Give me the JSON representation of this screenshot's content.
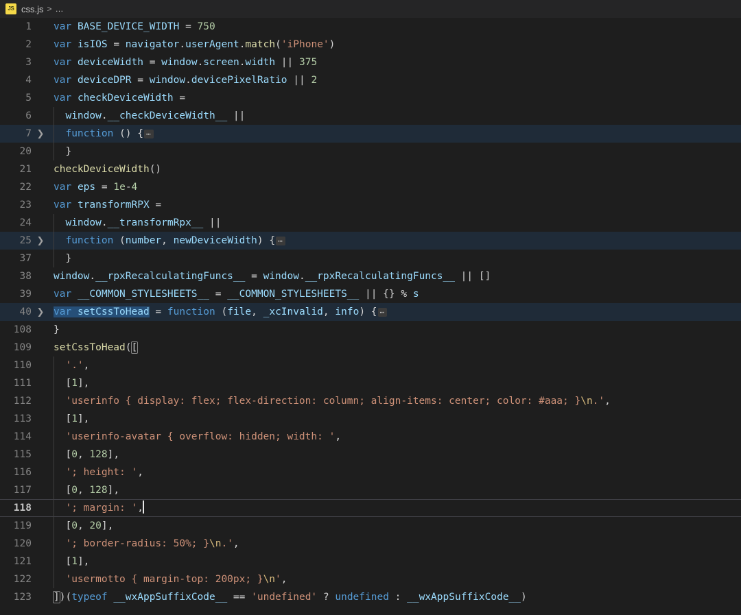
{
  "breadcrumb": {
    "file_icon_label": "JS",
    "file_name": "css.js",
    "separator": ">",
    "overflow": "…"
  },
  "editor": {
    "language": "javascript",
    "theme": "dark-plus",
    "active_line": 118,
    "colors": {
      "background": "#1e1e1e",
      "gutter_text": "#858585",
      "active_gutter_text": "#c6c6c6",
      "fold_highlight": "#1f2b38",
      "selection": "#264f78",
      "keyword": "#569cd6",
      "identifier": "#9cdcfe",
      "function": "#dcdcaa",
      "number": "#b5cea8",
      "string": "#ce9178",
      "escape": "#d7ba7d",
      "plain": "#d4d4d4",
      "indent_guide": "#404040",
      "caret": "#e8e8e8"
    },
    "lines": [
      {
        "n": "1",
        "text": "var BASE_DEVICE_WIDTH = 750"
      },
      {
        "n": "2",
        "text": "var isIOS = navigator.userAgent.match('iPhone')"
      },
      {
        "n": "3",
        "text": "var deviceWidth = window.screen.width || 375"
      },
      {
        "n": "4",
        "text": "var deviceDPR = window.devicePixelRatio || 2"
      },
      {
        "n": "5",
        "text": "var checkDeviceWidth ="
      },
      {
        "n": "6",
        "text": "  window.__checkDeviceWidth__ ||"
      },
      {
        "n": "7",
        "text": "  function () {…",
        "folded": true,
        "highlighted": true
      },
      {
        "n": "20",
        "text": "  }"
      },
      {
        "n": "21",
        "text": "checkDeviceWidth()"
      },
      {
        "n": "22",
        "text": "var eps = 1e-4"
      },
      {
        "n": "23",
        "text": "var transformRPX ="
      },
      {
        "n": "24",
        "text": "  window.__transformRpx__ ||"
      },
      {
        "n": "25",
        "text": "  function (number, newDeviceWidth) {…",
        "folded": true,
        "highlighted": true
      },
      {
        "n": "37",
        "text": "  }"
      },
      {
        "n": "38",
        "text": "window.__rpxRecalculatingFuncs__ = window.__rpxRecalculatingFuncs__ || []"
      },
      {
        "n": "39",
        "text": "var __COMMON_STYLESHEETS__ = __COMMON_STYLESHEETS__ || {} % s"
      },
      {
        "n": "40",
        "text": "var setCssToHead = function (file, _xcInvalid, info) {…",
        "folded": true,
        "highlighted": true,
        "selected_text": "var setCssToHead"
      },
      {
        "n": "108",
        "text": "}"
      },
      {
        "n": "109",
        "text": "setCssToHead(["
      },
      {
        "n": "110",
        "text": "  '.',"
      },
      {
        "n": "111",
        "text": "  [1],"
      },
      {
        "n": "112",
        "text": "  'userinfo { display: flex; flex-direction: column; align-items: center; color: #aaa; }\\n.',"
      },
      {
        "n": "113",
        "text": "  [1],"
      },
      {
        "n": "114",
        "text": "  'userinfo-avatar { overflow: hidden; width: ',"
      },
      {
        "n": "115",
        "text": "  [0, 128],"
      },
      {
        "n": "116",
        "text": "  '; height: ',"
      },
      {
        "n": "117",
        "text": "  [0, 128],"
      },
      {
        "n": "118",
        "text": "  '; margin: ',",
        "active": true,
        "caret_after": true
      },
      {
        "n": "119",
        "text": "  [0, 20],"
      },
      {
        "n": "120",
        "text": "  '; border-radius: 50%; }\\n.',"
      },
      {
        "n": "121",
        "text": "  [1],"
      },
      {
        "n": "122",
        "text": "  'usermotto { margin-top: 200px; }\\n',"
      },
      {
        "n": "123",
        "text": "])(typeof __wxAppSuffixCode__ == 'undefined' ? undefined : __wxAppSuffixCode__)"
      }
    ]
  }
}
